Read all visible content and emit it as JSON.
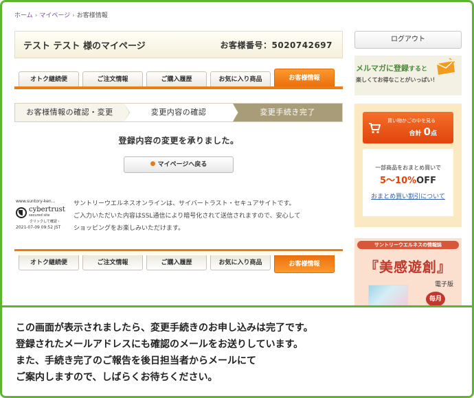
{
  "breadcrumb": {
    "home": "ホーム",
    "mypage": "マイページ",
    "current": "お客様情報",
    "sep": "›"
  },
  "title": {
    "name": "テスト テスト 様のマイページ",
    "customer_no": "お客様番号：5020742697"
  },
  "tabs": [
    "オトク継続便",
    "ご注文情報",
    "ご購入履歴",
    "お気に入り商品",
    "お客様情報"
  ],
  "steps": [
    "お客様情報の確認・変更",
    "変更内容の確認",
    "変更手続き完了"
  ],
  "message": "登録内容の変更を承りました。",
  "back_button": "マイページへ戻る",
  "seal": {
    "url": "www.suntory-ken...",
    "brand": "cybertrust",
    "sub": "secured site",
    "click": "クリックして確認 ›",
    "date": "2021-07-09 09:52 JST"
  },
  "security_text": [
    "サントリーウエルネスオンラインは、サイバートラスト・セキュアサイトです。",
    "ご入力いただいた内容はSSL通信により暗号化されて送信されますので、安心して",
    "ショッピングをお楽しみいただけます。"
  ],
  "side": {
    "logout": "ログアウト",
    "mailmag": {
      "line1_bold": "メルマガに登録",
      "line1_rest": "すると",
      "line2": "楽しくてお得なことがいっぱい！"
    },
    "cart": {
      "label": "買い物かごの中を見る",
      "total_prefix": "合計",
      "count": "0",
      "unit": "点"
    },
    "matome": {
      "line1": "一部商品をおまとめ買いで",
      "percent": "5〜10%",
      "off": "OFF",
      "link": "おまとめ買い割引について"
    },
    "bikan": {
      "header": "サントリーウエルネスの情報誌",
      "title": "『美感遊創』",
      "edition": "電子版",
      "badge": "毎月"
    }
  },
  "note": [
    "この画面が表示されましたら、変更手続きのお申し込みは完了です。",
    "登録されたメールアドレスにも確認のメールをお送りしています。",
    "また、手続き完了のご報告を後日担当者からメールにて",
    "ご案内しますので、しばらくお待ちください。"
  ]
}
